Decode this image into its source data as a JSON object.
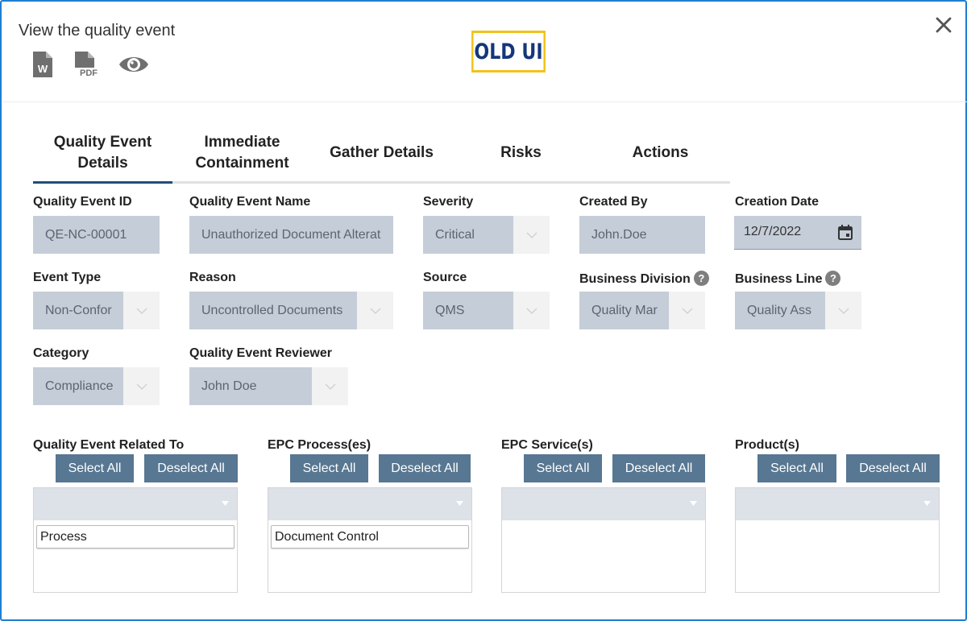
{
  "header": {
    "title": "View the quality event",
    "badge": "OLD UI",
    "word_icon_letter": "W",
    "pdf_icon_text": "PDF"
  },
  "tabs": [
    {
      "label": "Quality Event Details",
      "active": true
    },
    {
      "label": "Immediate Containment",
      "active": false
    },
    {
      "label": "Gather Details",
      "active": false
    },
    {
      "label": "Risks",
      "active": false
    },
    {
      "label": "Actions",
      "active": false
    }
  ],
  "form": {
    "event_id": {
      "label": "Quality Event ID",
      "value": "QE-NC-00001"
    },
    "event_name": {
      "label": "Quality Event Name",
      "value": "Unauthorized Document Alterat"
    },
    "severity": {
      "label": "Severity",
      "value": "Critical"
    },
    "created_by": {
      "label": "Created By",
      "value": "John.Doe"
    },
    "creation_date": {
      "label": "Creation Date",
      "value": "12/7/2022"
    },
    "event_type": {
      "label": "Event Type",
      "value": "Non-Confor"
    },
    "reason": {
      "label": "Reason",
      "value": "Uncontrolled Documents"
    },
    "source": {
      "label": "Source",
      "value": "QMS"
    },
    "business_division": {
      "label": "Business Division",
      "value": "Quality Mar",
      "help": "?"
    },
    "business_line": {
      "label": "Business Line",
      "value": "Quality Ass",
      "help": "?"
    },
    "category": {
      "label": "Category",
      "value": "Compliance"
    },
    "reviewer": {
      "label": "Quality Event Reviewer",
      "value": "John Doe"
    }
  },
  "lists": [
    {
      "label": "Quality Event Related To",
      "select_all": "Select All",
      "deselect_all": "Deselect All",
      "items": [
        "Process"
      ]
    },
    {
      "label": "EPC Process(es)",
      "select_all": "Select All",
      "deselect_all": "Deselect All",
      "items": [
        "Document Control"
      ]
    },
    {
      "label": "EPC Service(s)",
      "select_all": "Select All",
      "deselect_all": "Deselect All",
      "items": []
    },
    {
      "label": "Product(s)",
      "select_all": "Select All",
      "deselect_all": "Deselect All",
      "items": []
    }
  ],
  "colors": {
    "frame_border": "#1e7fd0",
    "badge_border": "#f2c21a",
    "badge_text": "#14377a",
    "button": "#577792",
    "field_bg": "#c5cdd8",
    "active_tab": "#1f4e79"
  }
}
